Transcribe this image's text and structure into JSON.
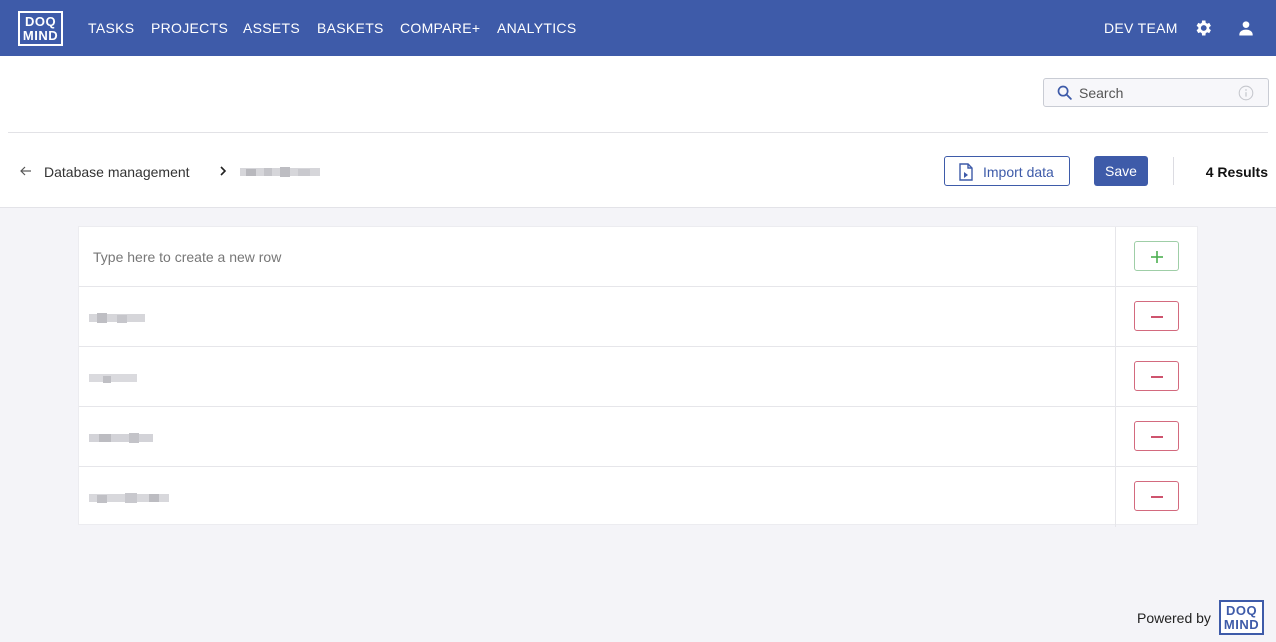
{
  "nav": {
    "logo_top": "DOQ",
    "logo_bottom": "MIND",
    "items": [
      "TASKS",
      "PROJECTS",
      "ASSETS",
      "BASKETS",
      "COMPARE+",
      "ANALYTICS"
    ],
    "team": "DEV TEAM",
    "settings_icon": "gear-icon",
    "user_icon": "user-icon"
  },
  "search": {
    "placeholder": "Search"
  },
  "breadcrumb": {
    "parent": "Database management",
    "current": ""
  },
  "toolbar": {
    "import_label": "Import data",
    "save_label": "Save",
    "results": "4 Results"
  },
  "table": {
    "new_row_placeholder": "Type here to create a new row",
    "rows": [
      "",
      "",
      "",
      ""
    ]
  },
  "footer": {
    "powered_by": "Powered by",
    "logo_top": "DOQ",
    "logo_bottom": "MIND"
  },
  "colors": {
    "brand": "#3e5ba9",
    "add": "#4caf50",
    "remove": "#c2294a"
  }
}
